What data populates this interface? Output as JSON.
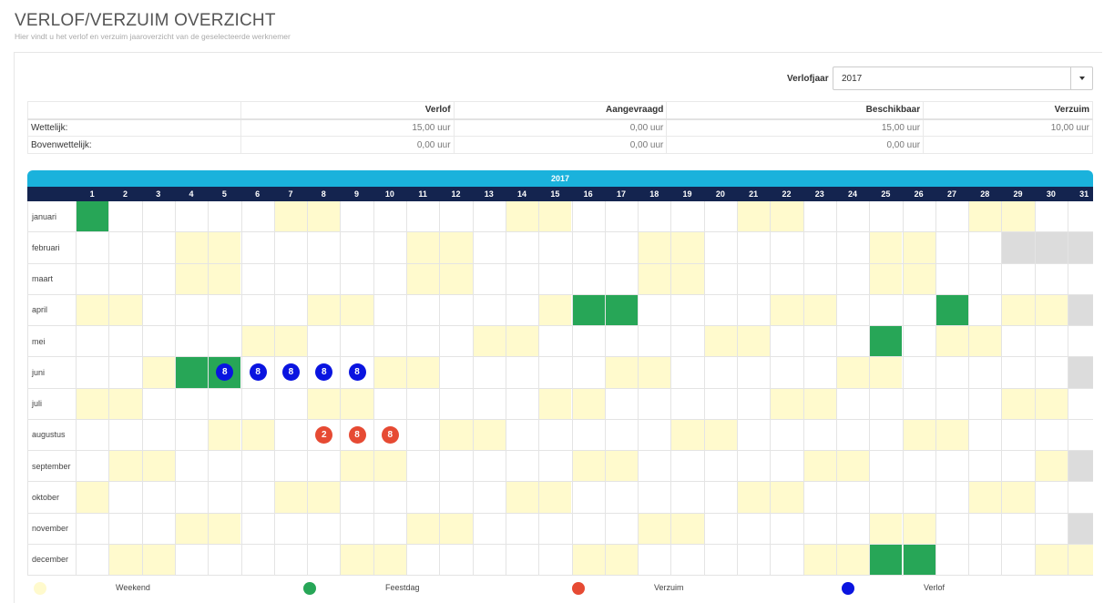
{
  "page": {
    "title": "VERLOF/VERZUIM OVERZICHT",
    "subtitle": "Hier vindt u het verlof en verzuim jaaroverzicht van de geselecteerde werknemer"
  },
  "filter": {
    "label": "Verlofjaar",
    "selected": "2017"
  },
  "summary": {
    "headers": [
      "",
      "Verlof",
      "Aangevraagd",
      "Beschikbaar",
      "Verzuim"
    ],
    "rows": [
      {
        "label": "Wettelijk:",
        "values": [
          "15,00 uur",
          "0,00 uur",
          "15,00 uur",
          "10,00 uur"
        ]
      },
      {
        "label": "Bovenwettelijk:",
        "values": [
          "0,00 uur",
          "0,00 uur",
          "0,00 uur",
          ""
        ]
      }
    ]
  },
  "calendar": {
    "year": "2017",
    "months": [
      {
        "name": "januari",
        "weekend": [
          7,
          8,
          14,
          15,
          21,
          22,
          28,
          29
        ],
        "holiday": [
          1
        ],
        "invalid": [],
        "verlof": {},
        "verzuim": {}
      },
      {
        "name": "februari",
        "weekend": [
          4,
          5,
          11,
          12,
          18,
          19,
          25,
          26
        ],
        "holiday": [],
        "invalid": [
          29,
          30,
          31
        ],
        "verlof": {},
        "verzuim": {}
      },
      {
        "name": "maart",
        "weekend": [
          4,
          5,
          11,
          12,
          18,
          19,
          25,
          26
        ],
        "holiday": [],
        "invalid": [],
        "verlof": {},
        "verzuim": {}
      },
      {
        "name": "april",
        "weekend": [
          1,
          2,
          8,
          9,
          15,
          22,
          23,
          29,
          30
        ],
        "holiday": [
          16,
          17,
          27
        ],
        "invalid": [
          31
        ],
        "verlof": {},
        "verzuim": {}
      },
      {
        "name": "mei",
        "weekend": [
          6,
          7,
          13,
          14,
          20,
          21,
          27,
          28
        ],
        "holiday": [
          25
        ],
        "invalid": [],
        "verlof": {},
        "verzuim": {}
      },
      {
        "name": "juni",
        "weekend": [
          3,
          10,
          11,
          17,
          18,
          24,
          25
        ],
        "holiday": [
          4,
          5
        ],
        "invalid": [
          31
        ],
        "verlof": {
          "5": "8",
          "6": "8",
          "7": "8",
          "8": "8",
          "9": "8"
        },
        "verzuim": {}
      },
      {
        "name": "juli",
        "weekend": [
          1,
          2,
          8,
          9,
          15,
          16,
          22,
          23,
          29,
          30
        ],
        "holiday": [],
        "invalid": [],
        "verlof": {},
        "verzuim": {}
      },
      {
        "name": "augustus",
        "weekend": [
          5,
          6,
          12,
          13,
          19,
          20,
          26,
          27
        ],
        "holiday": [],
        "invalid": [],
        "verlof": {},
        "verzuim": {
          "8": "2",
          "9": "8",
          "10": "8"
        }
      },
      {
        "name": "september",
        "weekend": [
          2,
          3,
          9,
          10,
          16,
          17,
          23,
          24,
          30
        ],
        "holiday": [],
        "invalid": [
          31
        ],
        "verlof": {},
        "verzuim": {}
      },
      {
        "name": "oktober",
        "weekend": [
          1,
          7,
          8,
          14,
          15,
          21,
          22,
          28,
          29
        ],
        "holiday": [],
        "invalid": [],
        "verlof": {},
        "verzuim": {}
      },
      {
        "name": "november",
        "weekend": [
          4,
          5,
          11,
          12,
          18,
          19,
          25,
          26
        ],
        "holiday": [],
        "invalid": [
          31
        ],
        "verlof": {},
        "verzuim": {}
      },
      {
        "name": "december",
        "weekend": [
          2,
          3,
          9,
          10,
          16,
          17,
          23,
          24,
          30,
          31
        ],
        "holiday": [
          25,
          26
        ],
        "invalid": [],
        "verlof": {},
        "verzuim": {}
      }
    ]
  },
  "legend": [
    {
      "label": "Weekend",
      "color": "#fffacd"
    },
    {
      "label": "Feestdag",
      "color": "#27a657"
    },
    {
      "label": "Verzuim",
      "color": "#e64a33"
    },
    {
      "label": "Verlof",
      "color": "#0a14e0"
    }
  ]
}
